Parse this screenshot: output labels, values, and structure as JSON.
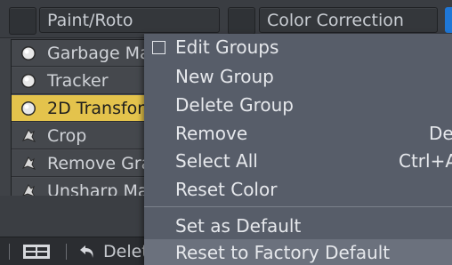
{
  "tabs": {
    "paint_roto": "Paint/Roto",
    "color_correction": "Color Correction"
  },
  "node_list": {
    "items": [
      {
        "label": "Garbage Ma",
        "icon": "garbage-matte-icon"
      },
      {
        "label": "Tracker",
        "icon": "tracker-icon"
      },
      {
        "label": "2D Transfor",
        "icon": "transform-2d-icon",
        "selected": true
      },
      {
        "label": "Crop",
        "icon": "crop-icon"
      },
      {
        "label": "Remove Gra",
        "icon": "remove-grain-icon"
      },
      {
        "label": "Unsharp Ma",
        "icon": "unsharp-mask-icon"
      }
    ]
  },
  "bottom_toolbar": {
    "delete_label": "Delet"
  },
  "context_menu": {
    "items": {
      "edit_groups": "Edit Groups",
      "new_group": "New Group",
      "delete_group": "Delete Group",
      "remove": "Remove",
      "remove_shortcut": "Del",
      "select_all": "Select All",
      "select_all_shortcut": "Ctrl+A",
      "reset_color": "Reset Color",
      "set_as_default": "Set as Default",
      "reset_to_factory_default": "Reset to Factory Default"
    }
  },
  "colors": {
    "selected_row": "#e4c34c",
    "menu_background": "#575d69",
    "accent_tab": "#1f77d6"
  }
}
